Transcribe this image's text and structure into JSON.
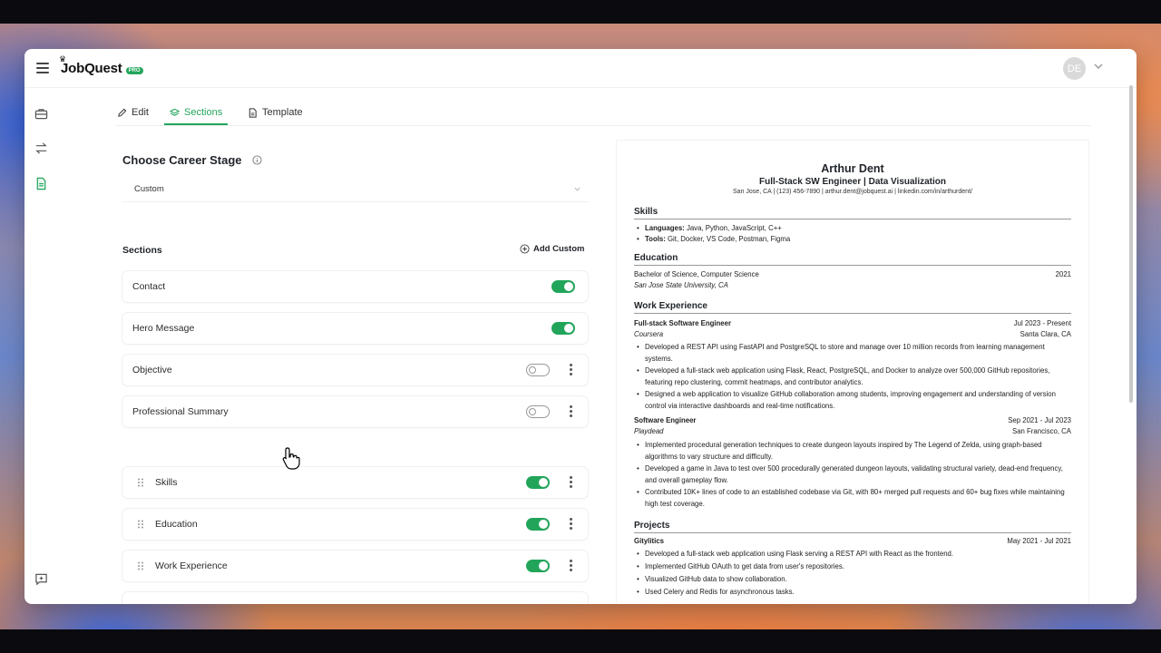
{
  "app": {
    "logo_text": "JobQuest",
    "logo_badge": "PRO",
    "avatar_initials": "DE"
  },
  "tabs": [
    {
      "label": "Edit",
      "icon": "pencil-icon"
    },
    {
      "label": "Sections",
      "icon": "layers-icon",
      "active": true
    },
    {
      "label": "Template",
      "icon": "document-icon"
    }
  ],
  "career_stage": {
    "title": "Choose Career Stage",
    "selected": "Custom"
  },
  "sections": {
    "label": "Sections",
    "add_custom": "Add Custom",
    "items": [
      {
        "label": "Contact",
        "enabled": true
      },
      {
        "label": "Hero Message",
        "enabled": true
      },
      {
        "label": "Objective",
        "enabled": false
      },
      {
        "label": "Professional Summary",
        "enabled": false
      },
      {
        "label": "Skills",
        "enabled": true
      },
      {
        "label": "Education",
        "enabled": true
      },
      {
        "label": "Work Experience",
        "enabled": true
      }
    ]
  },
  "resume": {
    "name": "Arthur Dent",
    "title": "Full-Stack SW Engineer | Data Visualization",
    "contact": "San Jose, CA | (123) 456-7890 | arthur.dent@jobquest.ai | linkedin.com/in/arthurdent/",
    "skills": {
      "heading": "Skills",
      "languages_label": "Languages:",
      "languages": "Java, Python, JavaScript, C++",
      "tools_label": "Tools:",
      "tools": "Git, Docker, VS Code, Postman, Figma"
    },
    "education": {
      "heading": "Education",
      "degree": "Bachelor of Science, Computer Science",
      "year": "2021",
      "school": "San Jose State University, CA"
    },
    "work": {
      "heading": "Work Experience",
      "jobs": [
        {
          "title": "Full-stack Software Engineer",
          "dates": "Jul 2023 - Present",
          "company": "Coursera",
          "location": "Santa Clara, CA",
          "bullets": [
            "Developed a REST API using FastAPI and PostgreSQL to store and manage over 10 million records from learning management systems.",
            "Developed a full-stack web application using Flask, React, PostgreSQL, and Docker to analyze over 500,000 GitHub repositories, featuring repo clustering, commit heatmaps, and contributor analytics.",
            "Designed a web application to visualize GitHub collaboration among students, improving engagement and understanding of version control via interactive dashboards and real-time notifications."
          ]
        },
        {
          "title": "Software Engineer",
          "dates": "Sep 2021 - Jul 2023",
          "company": "Playdead",
          "location": "San Francisco, CA",
          "bullets": [
            "Implemented procedural generation techniques to create dungeon layouts inspired by The Legend of Zelda, using graph-based algorithms to vary structure and difficulty.",
            "Developed a game in Java to test over 500 procedurally generated dungeon layouts, validating structural variety, dead-end frequency, and overall gameplay flow.",
            "Contributed 10K+ lines of code to an established codebase via Git, with 80+ merged pull requests and 60+ bug fixes while maintaining high test coverage."
          ]
        }
      ]
    },
    "projects": {
      "heading": "Projects",
      "items": [
        {
          "title": "Gitylitics",
          "dates": "May 2021 - Jul 2021",
          "bullets": [
            "Developed a full-stack web application using Flask serving a REST API with React as the frontend.",
            "Implemented GitHub OAuth to get data from user's repositories.",
            "Visualized GitHub data to show collaboration.",
            "Used Celery and Redis for asynchronous tasks."
          ]
        }
      ]
    }
  }
}
